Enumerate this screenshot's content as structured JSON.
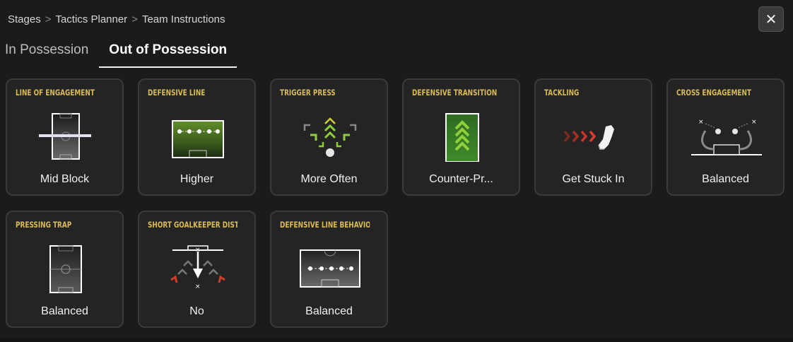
{
  "breadcrumb": {
    "items": [
      "Stages",
      "Tactics Planner",
      "Team Instructions"
    ],
    "separator": ">"
  },
  "close_button": {
    "icon": "close-icon",
    "glyph": "✕"
  },
  "tabs": [
    {
      "label": "In Possession",
      "active": false
    },
    {
      "label": "Out of Possession",
      "active": true
    }
  ],
  "cards": [
    {
      "title": "LINE OF ENGAGEMENT",
      "value": "Mid Block",
      "icon": "line-of-engagement-icon"
    },
    {
      "title": "DEFENSIVE LINE",
      "value": "Higher",
      "icon": "defensive-line-icon"
    },
    {
      "title": "TRIGGER PRESS",
      "value": "More Often",
      "icon": "trigger-press-icon"
    },
    {
      "title": "DEFENSIVE TRANSITION",
      "value": "Counter-Pr...",
      "icon": "defensive-transition-icon"
    },
    {
      "title": "TACKLING",
      "value": "Get Stuck In",
      "icon": "tackling-boot-icon"
    },
    {
      "title": "CROSS ENGAGEMENT",
      "value": "Balanced",
      "icon": "cross-engagement-icon"
    },
    {
      "title": "PRESSING TRAP",
      "value": "Balanced",
      "icon": "pressing-trap-icon"
    },
    {
      "title": "SHORT GOALKEEPER DISTRIBU",
      "value": "No",
      "icon": "goalkeeper-distribution-icon"
    },
    {
      "title": "DEFENSIVE LINE BEHAVIOUR",
      "value": "Balanced",
      "icon": "defensive-line-behaviour-icon"
    }
  ],
  "colors": {
    "accent_title": "#d9bb55",
    "card_bg": "#242424",
    "card_border": "#3a3a3a",
    "pitch_green": "#3f7a2a",
    "arrow_green": "#8fcf3a",
    "arrow_red": "#d23a2a"
  }
}
